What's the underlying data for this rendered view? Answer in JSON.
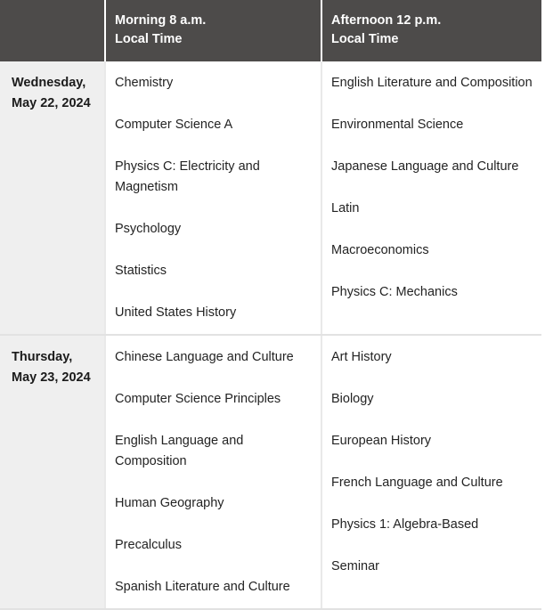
{
  "table": {
    "columns": [
      {
        "id": "date",
        "label": ""
      },
      {
        "id": "morning",
        "line1": "Morning 8 a.m.",
        "line2": "Local Time"
      },
      {
        "id": "afternoon",
        "line1": "Afternoon 12 p.m.",
        "line2": "Local Time"
      }
    ],
    "rows": [
      {
        "date_line1": "Wednesday,",
        "date_line2": "May 22, 2024",
        "morning": [
          "Chemistry",
          "Computer Science A",
          "Physics C: Electricity and Magnetism",
          "Psychology",
          "Statistics",
          "United States History"
        ],
        "afternoon": [
          "English Literature and Composition",
          "Environmental Science",
          "Japanese Language and Culture",
          "Latin",
          "Macroeconomics",
          "Physics C: Mechanics"
        ]
      },
      {
        "date_line1": "Thursday,",
        "date_line2": "May 23, 2024",
        "morning": [
          "Chinese Language and Culture",
          "Computer Science Principles",
          "English Language and Composition",
          "Human Geography",
          "Precalculus",
          "Spanish Literature and Culture"
        ],
        "afternoon": [
          "Art History",
          "Biology",
          "European History",
          "French Language and Culture",
          "Physics 1: Algebra-Based",
          "Seminar"
        ]
      }
    ]
  },
  "colors": {
    "header_background": "#4d4b4a",
    "header_text": "#ffffff",
    "date_cell_background": "#efefef",
    "body_text": "#232323",
    "row_divider": "#e2e2e2",
    "column_divider": "#e9e9e9"
  }
}
